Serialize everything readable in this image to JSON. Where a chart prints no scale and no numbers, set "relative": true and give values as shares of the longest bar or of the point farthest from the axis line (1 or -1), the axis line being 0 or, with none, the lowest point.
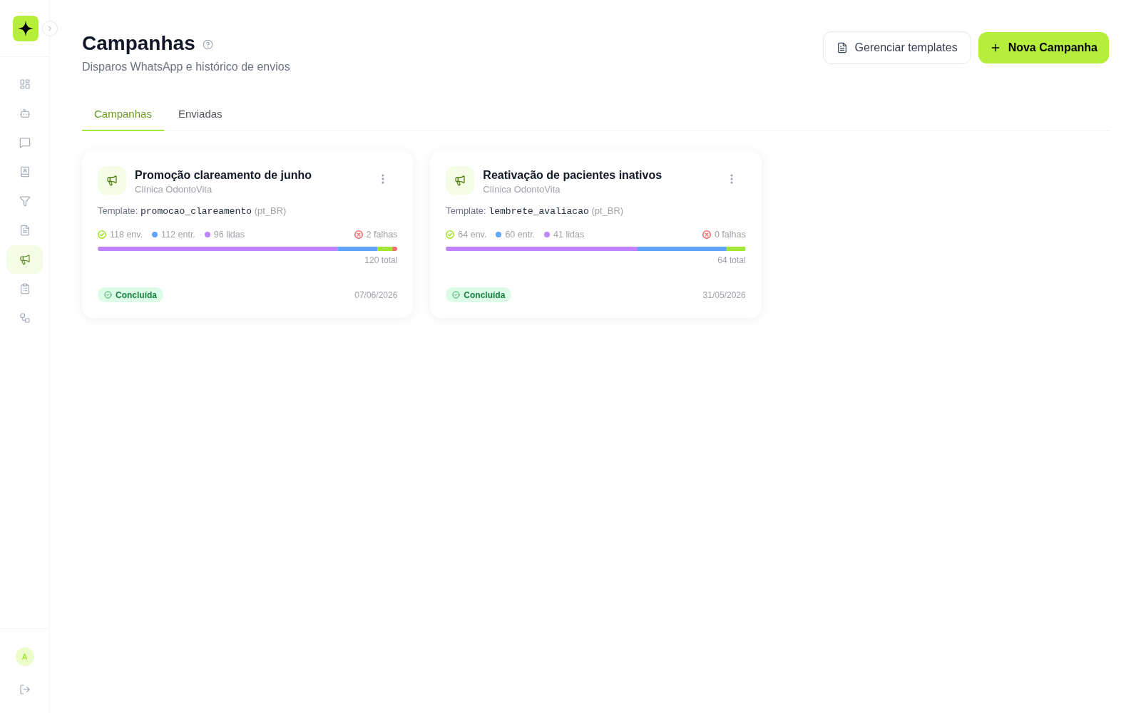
{
  "sidebar": {
    "items": [
      {
        "selected": false
      },
      {
        "selected": false
      },
      {
        "selected": false
      },
      {
        "selected": false
      },
      {
        "selected": false
      },
      {
        "selected": false
      },
      {
        "selected": true
      },
      {
        "selected": false
      },
      {
        "selected": false
      }
    ],
    "user": {
      "initial": "A"
    }
  },
  "header": {
    "title": "Campanhas",
    "subtitle": "Disparos WhatsApp e histórico de envios",
    "actions": [
      {
        "kind": "secondary",
        "label": "Gerenciar templates"
      },
      {
        "kind": "primary",
        "label": "Nova Campanha"
      }
    ]
  },
  "tabs": [
    {
      "label": "Campanhas",
      "selected": true
    },
    {
      "label": "Enviadas",
      "selected": false
    }
  ],
  "campaigns": [
    {
      "title": "Promoção clareamento de junho",
      "account": "Clínica OdontoVita",
      "template": {
        "label": "Template:",
        "name": "promocao_clareamento",
        "locale": "(pt_BR)"
      },
      "stats": [
        {
          "kind": "check",
          "label": "118 env.",
          "color": "#a3e635"
        },
        {
          "kind": "dot",
          "label": "112 entr.",
          "color": "#60a5fa"
        },
        {
          "kind": "dot",
          "label": "96 lidas",
          "color": "#c084fc"
        },
        {
          "kind": "fail",
          "label": "2 falhas",
          "color": "#f87171"
        }
      ],
      "chart_data": {
        "type": "bar",
        "orientation": "horizontal",
        "stacked": true,
        "relative": true,
        "series": [
          {
            "color": "#c084fc",
            "values": [
              0.8
            ]
          },
          {
            "color": "#60a5fa",
            "values": [
              0.133
            ]
          },
          {
            "color": "#a3e635",
            "values": [
              0.05
            ]
          },
          {
            "color": "#f87171",
            "values": [
              0.017
            ]
          }
        ]
      },
      "total": "120 total",
      "status": {
        "kind": "done",
        "label": "Concluída"
      },
      "date": "07/06/2026"
    },
    {
      "title": "Reativação de pacientes inativos",
      "account": "Clínica OdontoVita",
      "template": {
        "label": "Template:",
        "name": "lembrete_avaliacao",
        "locale": "(pt_BR)"
      },
      "stats": [
        {
          "kind": "check",
          "label": "64 env.",
          "color": "#a3e635"
        },
        {
          "kind": "dot",
          "label": "60 entr.",
          "color": "#60a5fa"
        },
        {
          "kind": "dot",
          "label": "41 lidas",
          "color": "#c084fc"
        },
        {
          "kind": "fail",
          "label": "0 falhas",
          "color": "#f87171"
        }
      ],
      "chart_data": {
        "type": "bar",
        "orientation": "horizontal",
        "stacked": true,
        "relative": true,
        "series": [
          {
            "color": "#c084fc",
            "values": [
              0.64
            ]
          },
          {
            "color": "#60a5fa",
            "values": [
              0.297
            ]
          },
          {
            "color": "#a3e635",
            "values": [
              0.063
            ]
          }
        ]
      },
      "total": "64 total",
      "status": {
        "kind": "done",
        "label": "Concluída"
      },
      "date": "31/05/2026"
    }
  ]
}
